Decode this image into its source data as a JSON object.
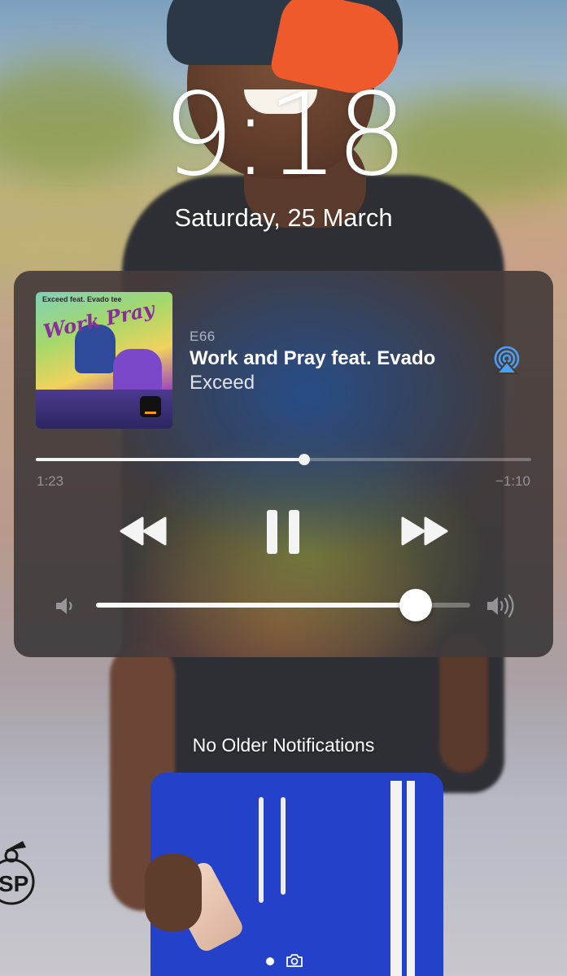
{
  "lockscreen": {
    "time": "9:18",
    "date": "Saturday, 25 March"
  },
  "now_playing": {
    "album": "E66",
    "title": "Work and Pray feat. Evado",
    "artist": "Exceed",
    "artwork": {
      "title_text": "Work Pray",
      "credit_text": "Exceed feat. Evado tee"
    },
    "elapsed": "1:23",
    "remaining": "−1:10",
    "progress_fraction": 0.542,
    "volume_fraction": 0.855,
    "icons": {
      "airplay": "airplay-icon",
      "rewind": "rewind-icon",
      "pause": "pause-icon",
      "forward": "fast-forward-icon",
      "volume_low": "speaker-low-icon",
      "volume_high": "speaker-high-icon"
    },
    "accent_color": "#4a9ff5"
  },
  "notifications": {
    "empty_text": "No Older Notifications"
  },
  "watermark": {
    "text": "SP"
  }
}
